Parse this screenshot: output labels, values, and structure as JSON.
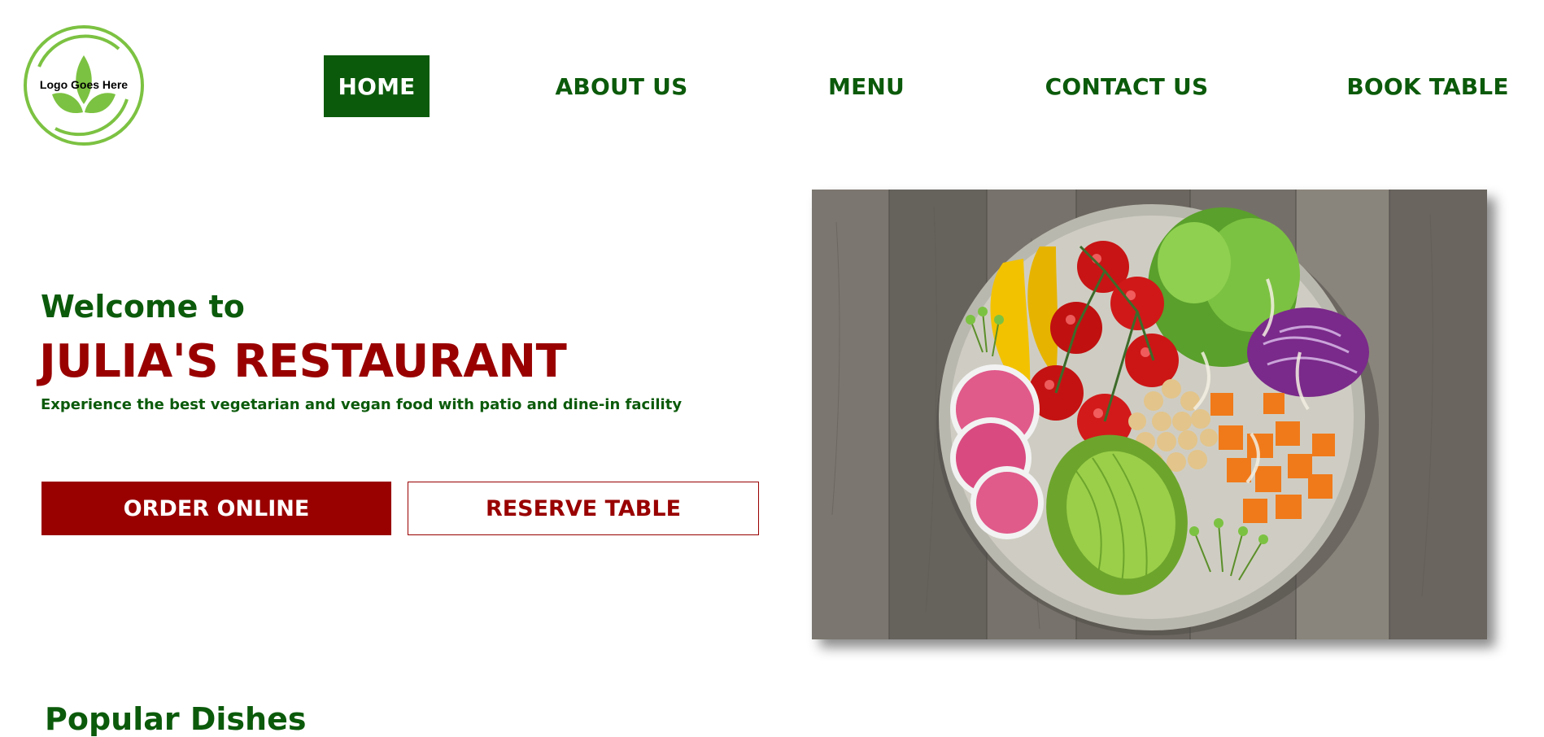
{
  "header": {
    "logo_text": "Logo Goes Here",
    "nav": [
      {
        "label": "HOME",
        "active": true
      },
      {
        "label": "ABOUT US",
        "active": false
      },
      {
        "label": "MENU",
        "active": false
      },
      {
        "label": "CONTACT US",
        "active": false
      },
      {
        "label": "BOOK TABLE",
        "active": false
      }
    ]
  },
  "hero": {
    "welcome": "Welcome to",
    "brand": "JULIA'S RESTAURANT",
    "tagline": "Experience the best vegetarian and vegan food with patio and dine-in facility",
    "order_label": "ORDER ONLINE",
    "reserve_label": "RESERVE TABLE",
    "image_icon": "salad-bowl-photo"
  },
  "sections": {
    "popular_title": "Popular Dishes"
  },
  "colors": {
    "primary_green": "#0b5a0b",
    "primary_red": "#990000",
    "logo_green": "#7cc242"
  }
}
